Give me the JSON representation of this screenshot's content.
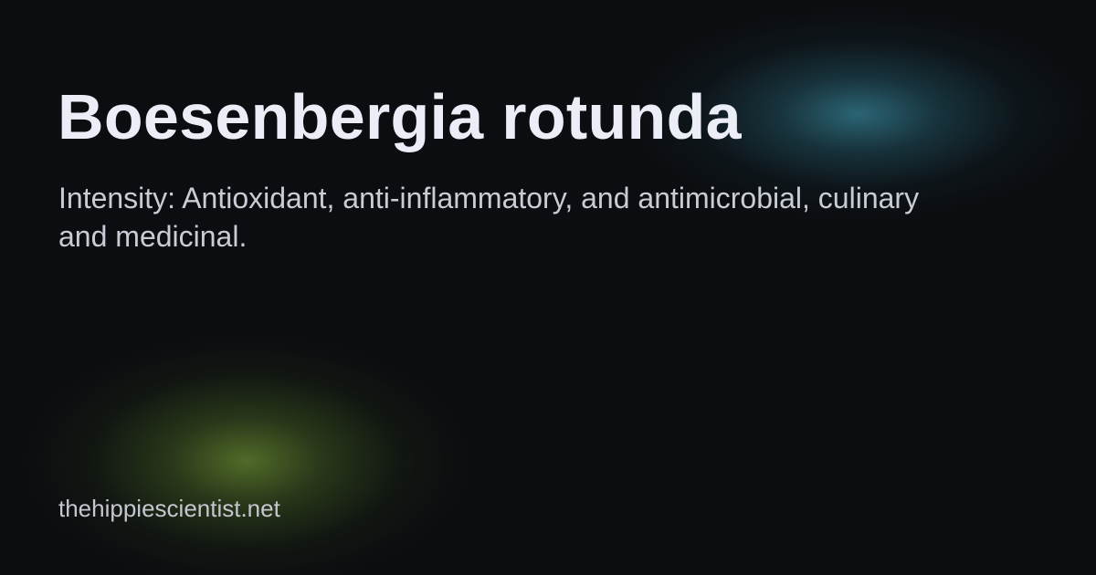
{
  "card": {
    "title": "Boesenbergia rotunda",
    "description": "Intensity: Antioxidant, anti-inflammatory, and antimicrobial, culinary and medicinal.",
    "site": "thehippiescientist.net"
  },
  "colors": {
    "background": "#0b0d10",
    "title": "#eceef7",
    "text": "#c9ccd4",
    "glow_teal": "#368296",
    "glow_green": "#688a30"
  }
}
